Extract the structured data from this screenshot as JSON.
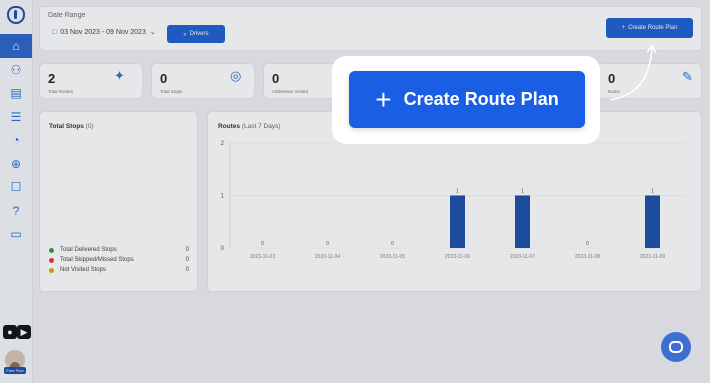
{
  "sidebar": {
    "logo_icon": "route-logo-icon",
    "items": [
      {
        "icon": "home-icon",
        "glyph": "⌂",
        "active": true
      },
      {
        "icon": "drivers-icon",
        "glyph": "⚇",
        "active": false
      },
      {
        "icon": "document-icon",
        "glyph": "▤",
        "active": false
      },
      {
        "icon": "list-icon",
        "glyph": "☰",
        "active": false
      },
      {
        "icon": "pie-chart-icon",
        "glyph": "◔",
        "active": false
      },
      {
        "icon": "target-icon",
        "glyph": "⊕",
        "active": false
      },
      {
        "icon": "contact-icon",
        "glyph": "☐",
        "active": false
      },
      {
        "icon": "help-icon",
        "glyph": "?",
        "active": false
      },
      {
        "icon": "chat-icon",
        "glyph": "▭",
        "active": false
      }
    ],
    "plan_label": "Free Plan"
  },
  "header": {
    "date_range_label": "Date Range",
    "date_range_value": "03 Nov 2023 - 09 Nov 2023",
    "drivers_label": "Drivers",
    "create_route_label": "Create Route Plan"
  },
  "stats": [
    {
      "value": "2",
      "label": "Total Routes",
      "icon": "route-icon"
    },
    {
      "value": "0",
      "label": "Total Stops",
      "icon": "location-pin-icon"
    },
    {
      "value": "0",
      "label": "Addresses Visited",
      "icon": ""
    },
    {
      "value": "0",
      "label": "Notes",
      "icon": "notes-icon"
    }
  ],
  "stops_card": {
    "title": "Total Stops",
    "count": "(0)",
    "legend": [
      {
        "label": "Total Delivered Stops",
        "value": "0",
        "color": "#2e9e44"
      },
      {
        "label": "Total Skipped/Missed Stops",
        "value": "0",
        "color": "#e03a3a"
      },
      {
        "label": "Not Visited Stops",
        "value": "0",
        "color": "#e0a800"
      }
    ]
  },
  "routes_card": {
    "title": "Routes",
    "subtitle": "(Last 7 Days)"
  },
  "chart_data": {
    "type": "bar",
    "title": "Routes",
    "categories": [
      "2023-11-03",
      "2023-11-04",
      "2023-11-05",
      "2023-11-06",
      "2023-11-07",
      "2023-11-08",
      "2023-11-09"
    ],
    "values": [
      0,
      0,
      0,
      1,
      1,
      0,
      1
    ],
    "ylim": [
      0,
      2
    ],
    "yticks": [
      0,
      1,
      2
    ],
    "color": "#1c4fa8"
  },
  "overlay": {
    "create_route_label": "Create Route Plan"
  }
}
